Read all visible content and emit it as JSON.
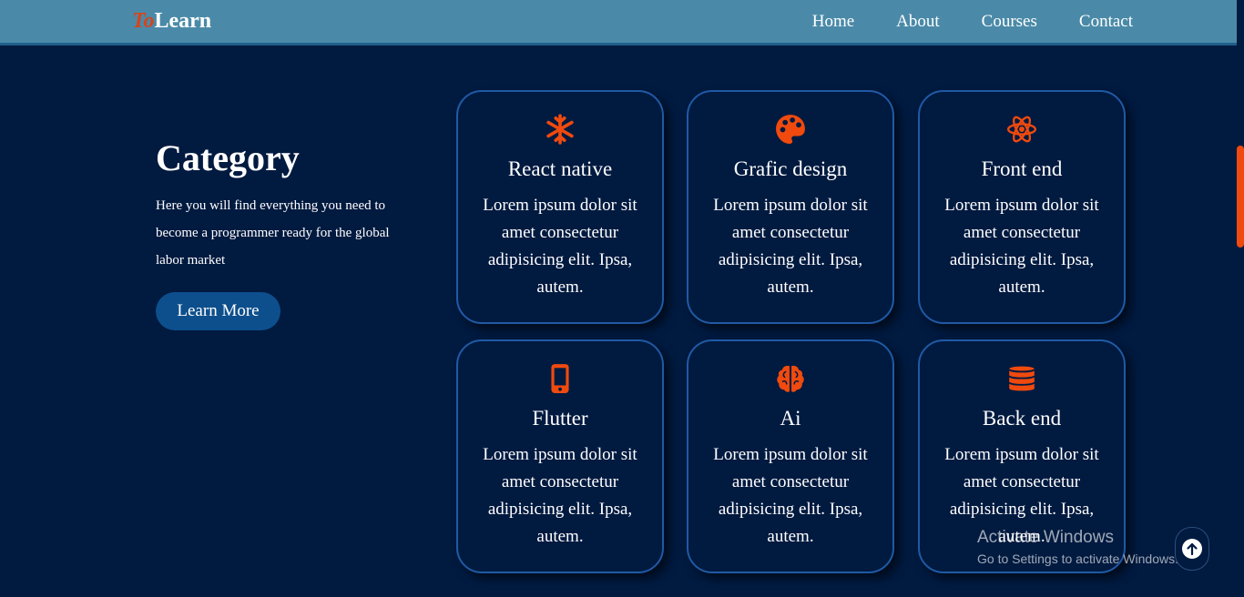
{
  "header": {
    "logo_accent": "To",
    "logo_main": "Learn",
    "nav": [
      "Home",
      "About",
      "Courses",
      "Contact"
    ]
  },
  "intro": {
    "title": "Category",
    "description": "Here you will find everything you need to become a programmer ready for the global labor market",
    "button_label": "Learn More"
  },
  "cards": [
    {
      "title": "React native",
      "icon": "snowflake-icon",
      "text": "Lorem ipsum dolor sit amet consectetur adipisicing elit. Ipsa, autem."
    },
    {
      "title": "Grafic design",
      "icon": "palette-icon",
      "text": "Lorem ipsum dolor sit amet consectetur adipisicing elit. Ipsa, autem."
    },
    {
      "title": "Front end",
      "icon": "atom-icon",
      "text": "Lorem ipsum dolor sit amet consectetur adipisicing elit. Ipsa, autem."
    },
    {
      "title": "Flutter",
      "icon": "mobile-icon",
      "text": "Lorem ipsum dolor sit amet consectetur adipisicing elit. Ipsa, autem."
    },
    {
      "title": "Ai",
      "icon": "brain-icon",
      "text": "Lorem ipsum dolor sit amet consectetur adipisicing elit. Ipsa, autem."
    },
    {
      "title": "Back end",
      "icon": "database-icon",
      "text": "Lorem ipsum dolor sit amet consectetur adipisicing elit. Ipsa, autem."
    }
  ],
  "watermark": {
    "line1": "Activate Windows",
    "line2": "Go to Settings to activate Windows."
  },
  "colors": {
    "background": "#011a40",
    "navbar": "#4a8aa8",
    "accent": "#f04a0e",
    "button": "#0d4f8c",
    "card_border": "#1f5aa5"
  }
}
